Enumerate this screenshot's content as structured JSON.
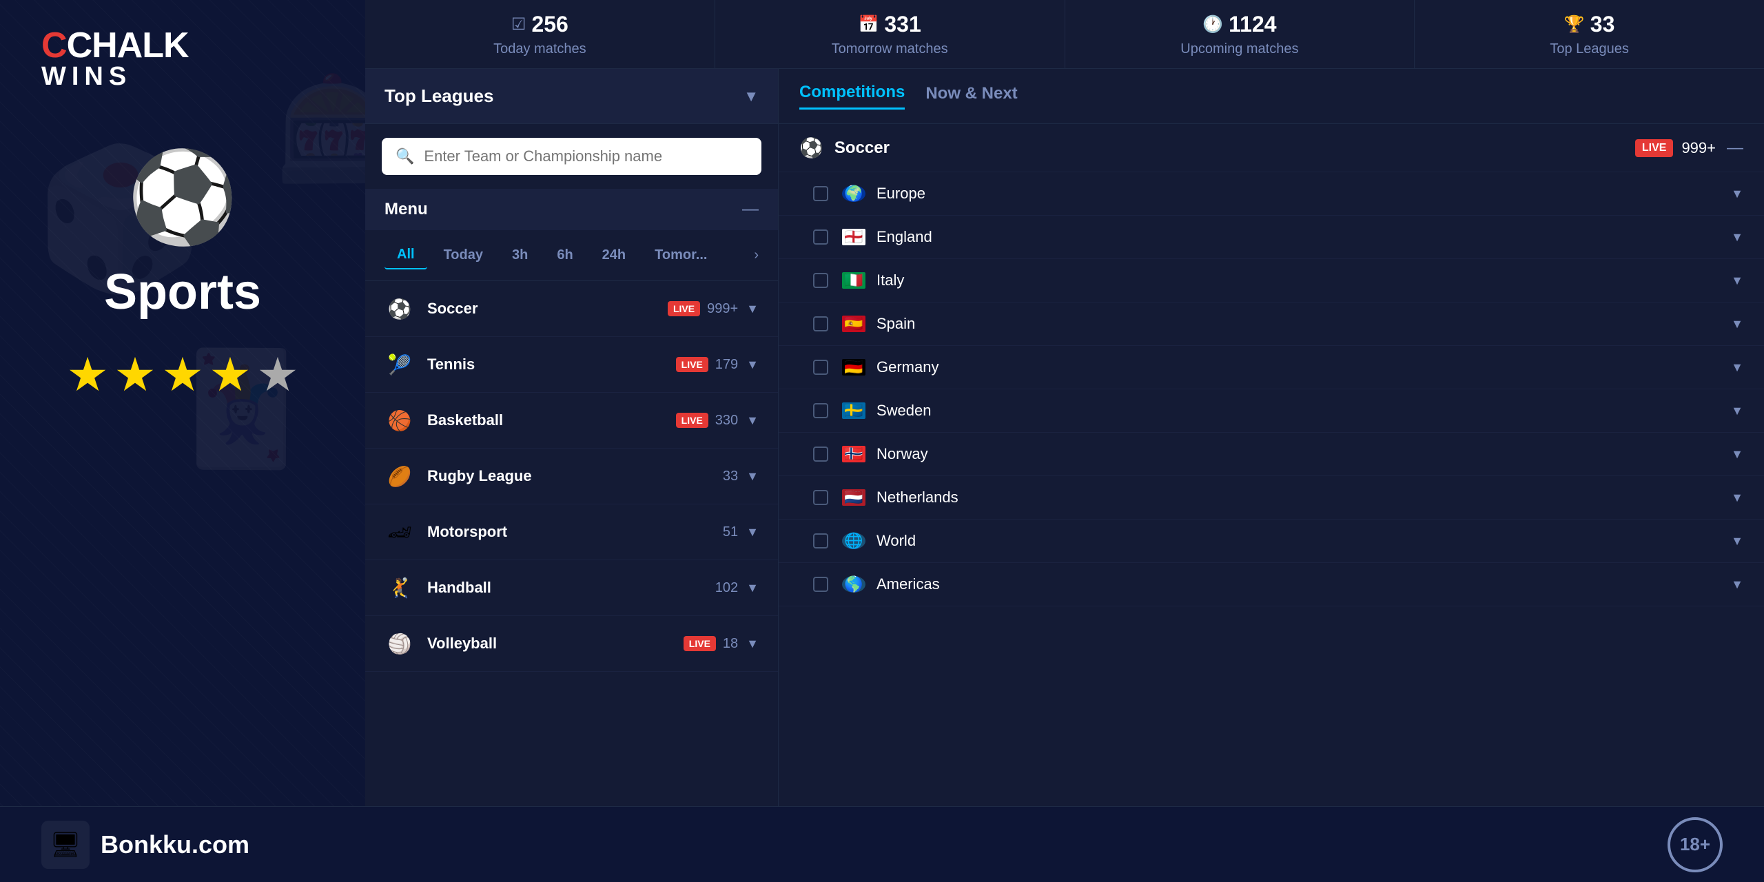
{
  "app": {
    "logo": {
      "chalk": "CHALK",
      "wins": "WINS"
    }
  },
  "left": {
    "sports_icon": "⚽",
    "sports_label": "Sports",
    "stars": [
      "★",
      "★",
      "★",
      "★",
      "☆"
    ]
  },
  "stats_bar": {
    "items": [
      {
        "icon": "☑",
        "count": "256",
        "label": "Today matches"
      },
      {
        "icon": "📅",
        "count": "331",
        "label": "Tomorrow matches"
      },
      {
        "icon": "🕐",
        "count": "1124",
        "label": "Upcoming matches"
      },
      {
        "icon": "🏆",
        "count": "33",
        "label": "Top Leagues"
      }
    ]
  },
  "menu": {
    "top_leagues_label": "Top Leagues",
    "search_placeholder": "Enter Team or Championship name",
    "menu_title": "Menu",
    "time_filters": [
      "All",
      "Today",
      "3h",
      "6h",
      "24h",
      "Tomor..."
    ],
    "sports": [
      {
        "name": "Soccer",
        "live": true,
        "count": "999+",
        "icon": "⚽"
      },
      {
        "name": "Tennis",
        "live": true,
        "count": "179",
        "icon": "🎾"
      },
      {
        "name": "Basketball",
        "live": true,
        "count": "330",
        "icon": "🏀"
      },
      {
        "name": "Rugby League",
        "live": false,
        "count": "33",
        "icon": "🏉"
      },
      {
        "name": "Motorsport",
        "live": false,
        "count": "51",
        "icon": "🏎"
      },
      {
        "name": "Handball",
        "live": false,
        "count": "102",
        "icon": "🤾"
      },
      {
        "name": "Volleyball",
        "live": true,
        "count": "18",
        "icon": "🏐"
      }
    ]
  },
  "competitions": {
    "tabs": [
      {
        "label": "Competitions",
        "active": true
      },
      {
        "label": "Now & Next",
        "active": false
      }
    ],
    "soccer_section": {
      "name": "Soccer",
      "icon": "⚽",
      "live": true,
      "count": "999+"
    },
    "regions": [
      {
        "name": "Europe",
        "flag": "🌍",
        "flag_class": "flag-europe"
      },
      {
        "name": "England",
        "flag": "🏴󠁧󠁢󠁥󠁮󠁧󠁿",
        "flag_class": "flag-england"
      },
      {
        "name": "Italy",
        "flag": "🇮🇹",
        "flag_class": "flag-italy"
      },
      {
        "name": "Spain",
        "flag": "🇪🇸",
        "flag_class": "flag-spain"
      },
      {
        "name": "Germany",
        "flag": "🇩🇪",
        "flag_class": "flag-germany"
      },
      {
        "name": "Sweden",
        "flag": "🇸🇪",
        "flag_class": "flag-sweden"
      },
      {
        "name": "Norway",
        "flag": "🇳🇴",
        "flag_class": "flag-norway"
      },
      {
        "name": "Netherlands",
        "flag": "🇳🇱",
        "flag_class": "flag-netherlands"
      },
      {
        "name": "World",
        "flag": "🌐",
        "flag_class": "flag-world"
      },
      {
        "name": "Americas",
        "flag": "🌎",
        "flag_class": "flag-americas"
      }
    ]
  },
  "footer": {
    "bonkku_icon": "🖥",
    "bonkku_text": "Bonkku.com",
    "age_label": "18+"
  },
  "colors": {
    "accent_blue": "#00c2ff",
    "live_red": "#e53935",
    "bg_dark": "#0d1535",
    "bg_panel": "#141b35",
    "text_muted": "#7a8cbb"
  }
}
